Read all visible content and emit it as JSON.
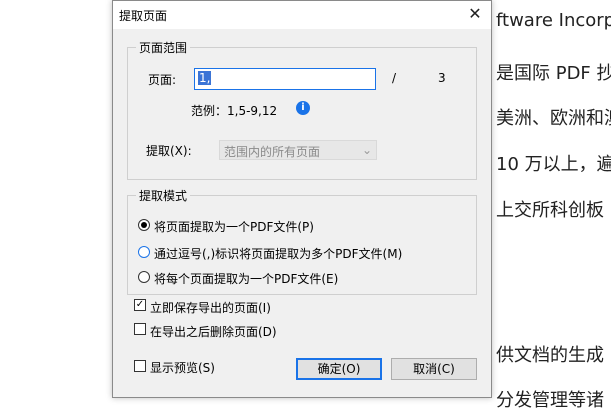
{
  "background": {
    "line1": "ftware Incorp",
    "line2": "是国际 PDF 抄",
    "line3": "美洲、欧洲和澳",
    "line4": "10 万以上，遍",
    "line5": "上交所科创板",
    "line6": "供文档的生成",
    "line7": "分发管理等诸"
  },
  "dialog": {
    "title": "提取页面",
    "close_glyph": "✕",
    "page_range": {
      "group_label": "页面范围",
      "pages_label": "页面:",
      "pages_value": "1,",
      "slash": "/",
      "total_pages": "3",
      "example": "范例：1,5-9,12",
      "info_glyph": "i",
      "extract_label": "提取(X):",
      "extract_option": "范围内的所有页面",
      "chevron": "⌄"
    },
    "mode": {
      "group_label": "提取模式",
      "options": [
        {
          "label": "将页面提取为一个PDF文件(P)",
          "checked": true
        },
        {
          "label": "通过逗号(,)标识将页面提取为多个PDF文件(M)",
          "checked": false
        },
        {
          "label": "将每个页面提取为一个PDF文件(E)",
          "checked": false
        }
      ]
    },
    "save_immediately": {
      "label": "立即保存导出的页面(I)",
      "checked": true,
      "mark": "✓"
    },
    "delete_after": {
      "label": "在导出之后删除页面(D)",
      "checked": false
    },
    "show_preview": {
      "label": "显示预览(S)",
      "checked": false
    },
    "ok_label": "确定(O)",
    "cancel_label": "取消(C)"
  }
}
